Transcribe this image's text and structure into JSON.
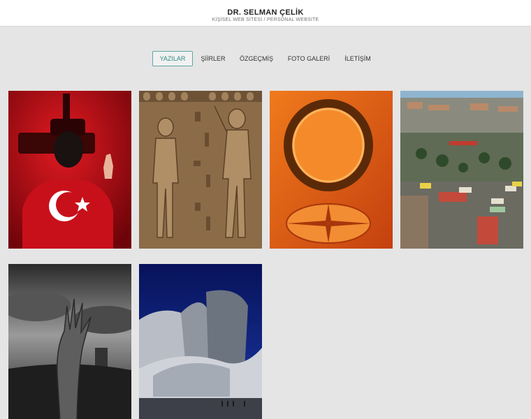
{
  "header": {
    "title": "DR. SELMAN ÇELİK",
    "subtitle": "KİŞİSEL WEB SİTESİ / PERSONAL WEBSITE"
  },
  "nav": {
    "items": [
      {
        "label": "YAZILAR",
        "active": true
      },
      {
        "label": "ŞİİRLER",
        "active": false
      },
      {
        "label": "ÖZGEÇMİŞ",
        "active": false
      },
      {
        "label": "FOTO GALERİ",
        "active": false
      },
      {
        "label": "İLETİŞİM",
        "active": false
      }
    ]
  },
  "gallery": {
    "tiles": [
      {
        "subject": "person-with-flag-shirt",
        "accent": "#c8101a"
      },
      {
        "subject": "egyptian-relief",
        "accent": "#8a6a45"
      },
      {
        "subject": "compass-ring",
        "accent": "#e0601a"
      },
      {
        "subject": "city-square-aerial",
        "accent": "#6d7a6b"
      },
      {
        "subject": "zombie-hand-landscape",
        "accent": "#3a3a3a"
      },
      {
        "subject": "modern-building",
        "accent": "#0a1f6a"
      }
    ]
  },
  "colors": {
    "background": "#e5e5e5",
    "header_bg": "#ffffff",
    "nav_active_border": "#5fa8a4",
    "nav_active_text": "#2f8c86"
  }
}
